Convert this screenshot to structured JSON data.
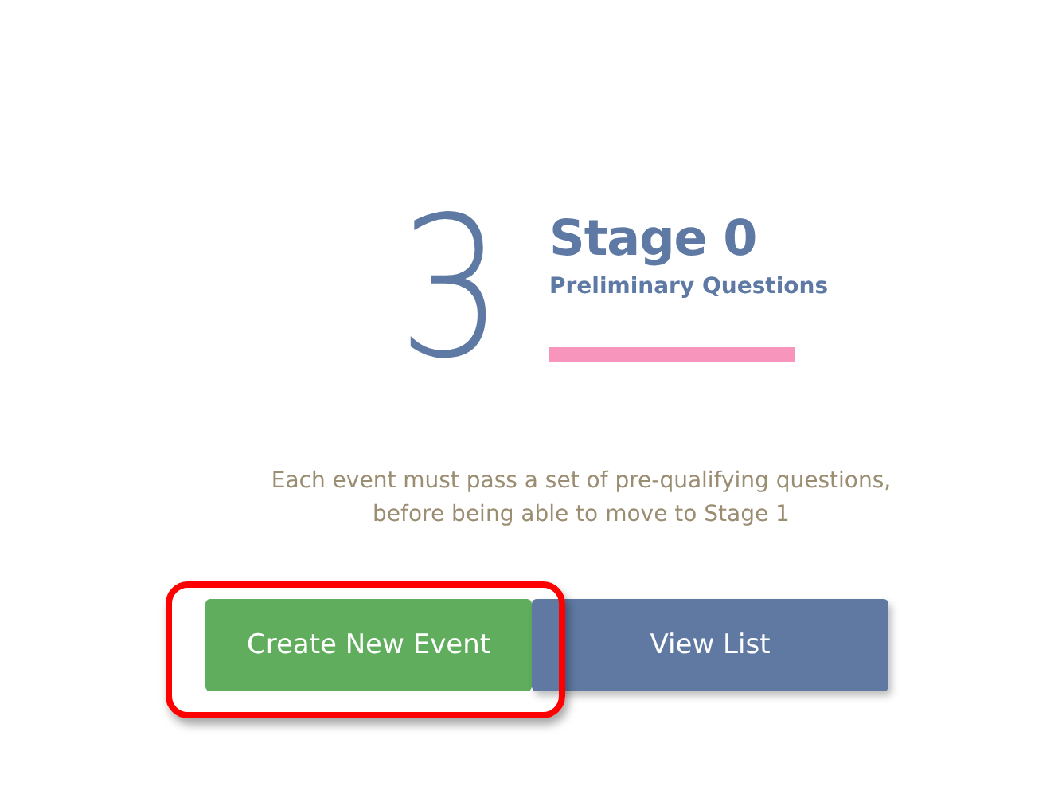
{
  "stage": {
    "number": "3",
    "title": "Stage 0",
    "subtitle": "Preliminary Questions"
  },
  "description": "Each event must pass a set of pre-qualifying questions, before being able to move to Stage 1",
  "buttons": [
    {
      "label": "Create New Event",
      "kind": "success",
      "highlighted": true
    },
    {
      "label": "View List",
      "kind": "primary",
      "highlighted": false
    }
  ]
}
